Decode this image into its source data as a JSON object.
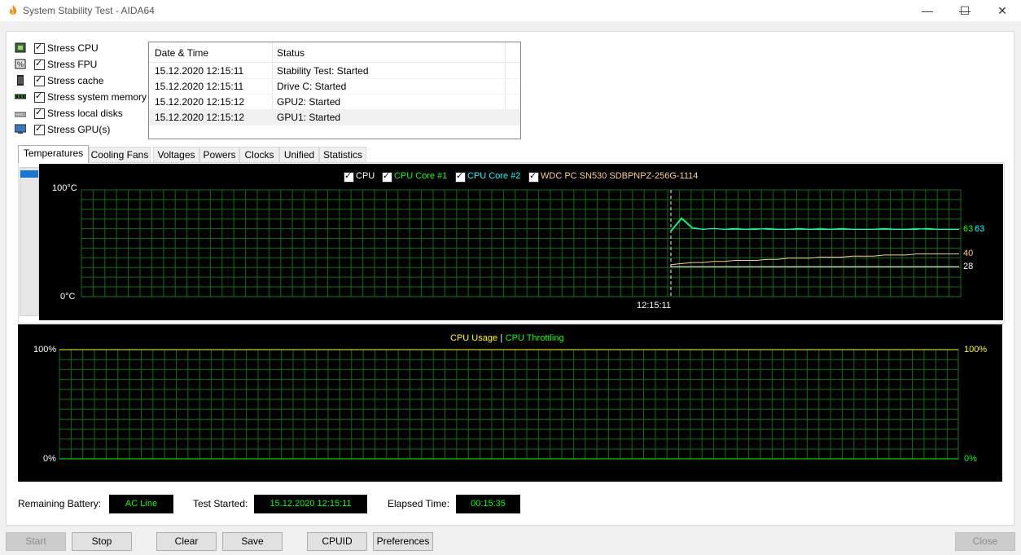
{
  "window": {
    "title": "System Stability Test - AIDA64",
    "minimize": "—",
    "maximize": "☐",
    "close": "✕"
  },
  "stress": [
    {
      "label": "Stress CPU",
      "icon": "cpu-icon",
      "checked": true
    },
    {
      "label": "Stress FPU",
      "icon": "fpu-icon",
      "checked": true
    },
    {
      "label": "Stress cache",
      "icon": "cache-icon",
      "checked": true
    },
    {
      "label": "Stress system memory",
      "icon": "memory-icon",
      "checked": true
    },
    {
      "label": "Stress local disks",
      "icon": "disk-icon",
      "checked": true
    },
    {
      "label": "Stress GPU(s)",
      "icon": "gpu-icon",
      "checked": true
    }
  ],
  "log": {
    "headers": [
      "Date & Time",
      "Status"
    ],
    "rows": [
      [
        "15.12.2020 12:15:11",
        "Stability Test: Started"
      ],
      [
        "15.12.2020 12:15:11",
        "Drive C: Started"
      ],
      [
        "15.12.2020 12:15:12",
        "GPU2: Started"
      ],
      [
        "15.12.2020 12:15:12",
        "GPU1: Started"
      ]
    ]
  },
  "tabs": [
    "Temperatures",
    "Cooling Fans",
    "Voltages",
    "Powers",
    "Clocks",
    "Unified",
    "Statistics"
  ],
  "temp_graph": {
    "legend": [
      {
        "label": "CPU",
        "color": "#ffffff"
      },
      {
        "label": "CPU Core #1",
        "color": "#00ff00"
      },
      {
        "label": "CPU Core #2",
        "color": "#00ffff"
      },
      {
        "label": "WDC PC SN530 SDBPNPZ-256G-1114",
        "color": "#ffd080"
      }
    ],
    "y_max_label": "100°C",
    "y_min_label": "0°C",
    "x_marker_label": "12:15:11",
    "value_labels": [
      {
        "text": "63",
        "color": "#00ff00"
      },
      {
        "text": "63",
        "color": "#00ffff"
      },
      {
        "text": "40",
        "color": "#ffd080"
      },
      {
        "text": "28",
        "color": "#ffffff"
      }
    ]
  },
  "usage_graph": {
    "legend_left": "CPU Usage",
    "legend_sep": "|",
    "legend_right": "CPU Throttling",
    "legend_left_color": "#ffff00",
    "legend_right_color": "#00ff00",
    "left_max": "100%",
    "left_min": "0%",
    "right_max": "100%",
    "right_min": "0%"
  },
  "chart_data": [
    {
      "type": "line",
      "title": "",
      "ylabel": "",
      "ylim": [
        0,
        100
      ],
      "x_marker": "12:15:11",
      "series": [
        {
          "name": "CPU",
          "color": "#ffffff",
          "values": [
            28,
            28,
            28,
            28,
            28,
            28,
            28,
            28,
            28,
            28,
            28,
            28,
            28,
            28,
            28,
            28,
            28,
            28,
            28,
            28,
            28,
            28,
            28,
            28,
            28,
            28,
            28,
            28
          ]
        },
        {
          "name": "CPU Core #1",
          "color": "#00ff00",
          "values": [
            62,
            74,
            65,
            63,
            64,
            63,
            63,
            63,
            64,
            63,
            63,
            63,
            63,
            63,
            64,
            63,
            63,
            63,
            63,
            63,
            63,
            63,
            63,
            64,
            63,
            63,
            63,
            63
          ]
        },
        {
          "name": "CPU Core #2",
          "color": "#00ffff",
          "values": [
            61,
            73,
            64,
            63,
            64,
            63,
            64,
            63,
            63,
            64,
            63,
            63,
            64,
            63,
            63,
            63,
            64,
            63,
            63,
            63,
            64,
            63,
            63,
            63,
            64,
            63,
            63,
            63
          ]
        },
        {
          "name": "WDC PC SN530 SDBPNPZ-256G-1114",
          "color": "#ffd080",
          "values": [
            30,
            31,
            32,
            32,
            33,
            33,
            34,
            34,
            34,
            35,
            35,
            36,
            36,
            36,
            37,
            37,
            37,
            38,
            38,
            38,
            39,
            39,
            39,
            40,
            40,
            40,
            40,
            40
          ]
        }
      ]
    },
    {
      "type": "line",
      "title": "",
      "ylim": [
        0,
        100
      ],
      "series": [
        {
          "name": "CPU Usage",
          "color": "#ffff00",
          "values": []
        },
        {
          "name": "CPU Throttling",
          "color": "#00ff00",
          "values": []
        }
      ]
    }
  ],
  "status": {
    "battery_label": "Remaining Battery:",
    "battery_value": "AC Line",
    "started_label": "Test Started:",
    "started_value": "15.12.2020 12:15:11",
    "elapsed_label": "Elapsed Time:",
    "elapsed_value": "00:15:35"
  },
  "buttons": {
    "start": "Start",
    "stop": "Stop",
    "clear": "Clear",
    "save": "Save",
    "cpuid": "CPUID",
    "preferences": "Preferences",
    "close": "Close"
  }
}
